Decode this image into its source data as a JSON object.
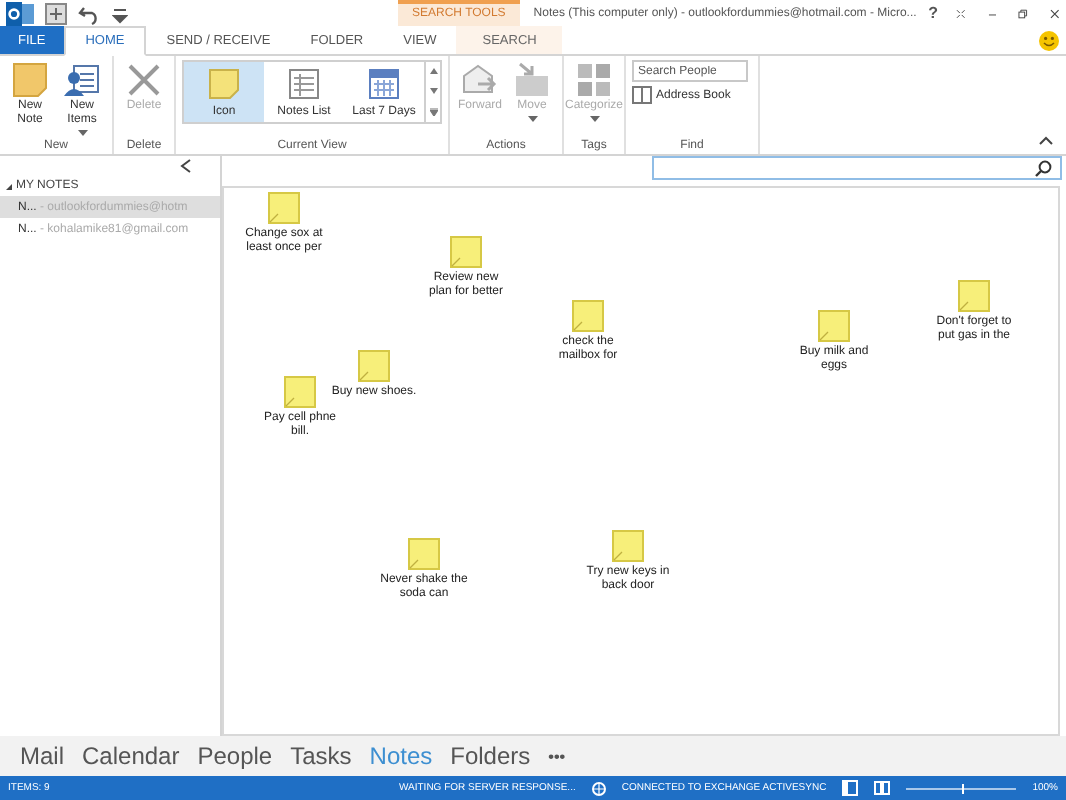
{
  "title_bar": {
    "contextual_tab": "SEARCH TOOLS",
    "title": "Notes (This computer only) - outlookfordummies@hotmail.com - Micro...",
    "help": "?"
  },
  "tabs": [
    {
      "label": "FILE",
      "kind": "file",
      "selected": false
    },
    {
      "label": "HOME",
      "kind": "tab",
      "selected": true
    },
    {
      "label": "SEND / RECEIVE",
      "kind": "tab",
      "selected": false
    },
    {
      "label": "FOLDER",
      "kind": "tab",
      "selected": false
    },
    {
      "label": "VIEW",
      "kind": "tab",
      "selected": false
    },
    {
      "label": "SEARCH",
      "kind": "contextual",
      "selected": false
    }
  ],
  "ribbon": [
    {
      "label": "New",
      "items": [
        {
          "label": "New Note",
          "kind": "note",
          "disabled": false
        },
        {
          "label": "New Items",
          "kind": "items",
          "disabled": false,
          "dropdown": true
        }
      ]
    },
    {
      "label": "Delete",
      "items": [
        {
          "label": "Delete",
          "kind": "delete",
          "disabled": true
        }
      ]
    },
    {
      "label": "Current View",
      "kind": "gallery",
      "items": [
        {
          "label": "Icon",
          "kind": "icon-view",
          "selected": true
        },
        {
          "label": "Notes List",
          "kind": "list-view",
          "selected": false
        },
        {
          "label": "Last 7 Days",
          "kind": "calendar-view",
          "selected": false
        }
      ]
    },
    {
      "label": "Actions",
      "items": [
        {
          "label": "Forward",
          "kind": "forward",
          "disabled": true
        },
        {
          "label": "Move",
          "kind": "move",
          "disabled": true,
          "dropdown": true
        }
      ]
    },
    {
      "label": "Tags",
      "items": [
        {
          "label": "Categorize",
          "kind": "categorize",
          "disabled": true,
          "dropdown": true
        }
      ]
    },
    {
      "label": "Find",
      "kind": "find",
      "search": {
        "placeholder": "Search People"
      },
      "link": "Address Book"
    }
  ],
  "folder_pane": {
    "header": "MY NOTES",
    "expanded": true,
    "items": [
      {
        "name": "N...",
        "account": "- outlookfordummies@hotm",
        "selected": true
      },
      {
        "name": "N...",
        "account": "- kohalamike81@gmail.com",
        "selected": false
      }
    ]
  },
  "notes": [
    {
      "text": "Change sox at least once per"
    },
    {
      "text": "Review new plan for better"
    },
    {
      "text": "Don't forget to put gas in the"
    },
    {
      "text": "check the mailbox for"
    },
    {
      "text": "Buy milk and eggs"
    },
    {
      "text": "Buy new shoes."
    },
    {
      "text": "Pay cell phne bill."
    },
    {
      "text": "Try new keys in back door"
    },
    {
      "text": "Never shake the soda can"
    }
  ],
  "nav": [
    {
      "label": "Mail",
      "selected": false
    },
    {
      "label": "Calendar",
      "selected": false
    },
    {
      "label": "People",
      "selected": false
    },
    {
      "label": "Tasks",
      "selected": false
    },
    {
      "label": "Notes",
      "selected": true
    },
    {
      "label": "Folders",
      "selected": false
    }
  ],
  "nav_more": "•••",
  "status_bar": {
    "items": "ITEMS: 9",
    "waiting": "WAITING FOR SERVER RESPONSE...",
    "connection": "CONNECTED TO EXCHANGE ACTIVESYNC",
    "zoom": "100%",
    "level": 0.5
  }
}
